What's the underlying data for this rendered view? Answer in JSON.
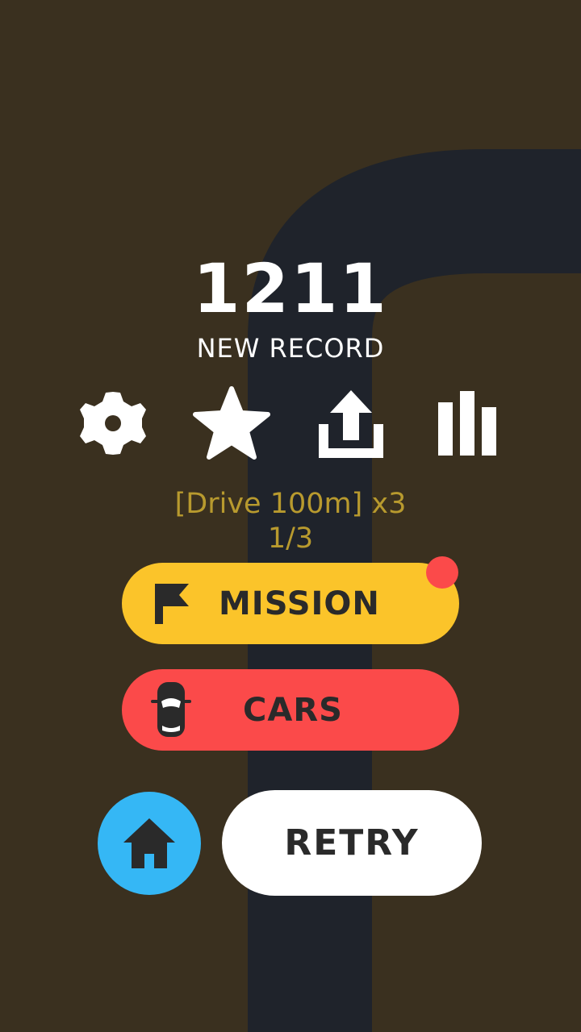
{
  "game": {
    "score": "1211",
    "record_label": "NEW RECORD"
  },
  "toolbar": {
    "icons": [
      "gear-icon",
      "star-icon",
      "share-icon",
      "leaderboard-icon"
    ]
  },
  "mission": {
    "task": "[Drive 100m] x3",
    "progress": "1/3"
  },
  "buttons": {
    "mission_label": "MISSION",
    "cars_label": "CARS",
    "retry_label": "RETRY"
  },
  "colors": {
    "background": "#3a301f",
    "road": "#1f232b",
    "mission_button": "#fbc42a",
    "cars_button": "#fb4a4a",
    "home_button": "#35b7f5",
    "mission_text": "#b89a2e",
    "badge": "#fb4a4a",
    "icon": "#ffffff"
  }
}
